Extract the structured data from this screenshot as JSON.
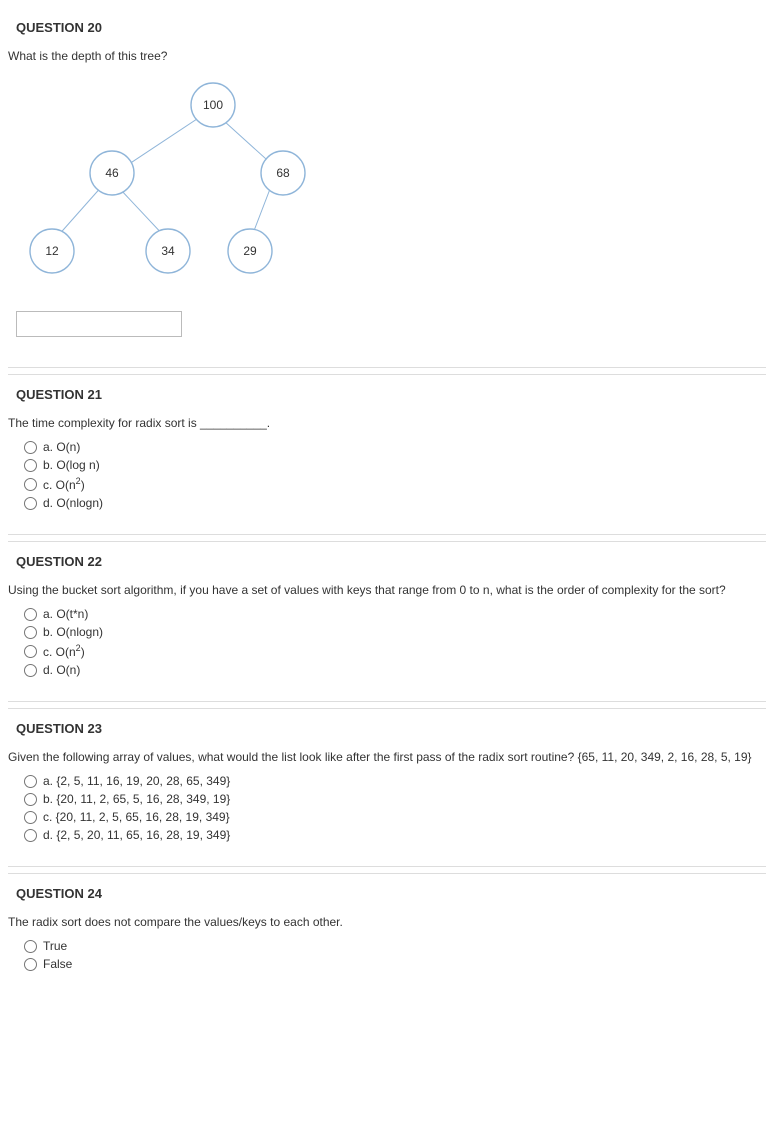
{
  "q20": {
    "title": "QUESTION 20",
    "prompt": "What is the depth of this tree?",
    "tree": {
      "n100": "100",
      "n46": "46",
      "n68": "68",
      "n12": "12",
      "n34": "34",
      "n29": "29"
    }
  },
  "q21": {
    "title": "QUESTION 21",
    "prompt": "The time complexity for radix sort is __________.",
    "a": "a. O(n)",
    "b": "b. O(log n)",
    "c_prefix": "c. O(n",
    "c_sup": "2",
    "c_suffix": ")",
    "d": "d. O(nlogn)"
  },
  "q22": {
    "title": "QUESTION 22",
    "prompt": "Using the bucket sort algorithm, if you have a set of values with keys that range from 0 to n, what is the order of complexity for the sort?",
    "a": "a. O(t*n)",
    "b": "b. O(nlogn)",
    "c_prefix": "c. O(n",
    "c_sup": "2",
    "c_suffix": ")",
    "d": "d. O(n)"
  },
  "q23": {
    "title": "QUESTION 23",
    "prompt": "Given the following array of values, what would the list look like after the first pass of the radix sort routine?   {65, 11, 20, 349, 2, 16, 28, 5, 19}",
    "a": "a. {2, 5, 11, 16, 19, 20, 28, 65, 349}",
    "b": "b. {20, 11, 2, 65, 5, 16, 28, 349, 19}",
    "c": "c. {20, 11, 2, 5, 65, 16, 28, 19, 349}",
    "d": "d. {2, 5, 20, 11, 65, 16, 28, 19, 349}"
  },
  "q24": {
    "title": "QUESTION 24",
    "prompt": "The radix sort does not compare the values/keys to each other.",
    "t": "True",
    "f": "False"
  }
}
